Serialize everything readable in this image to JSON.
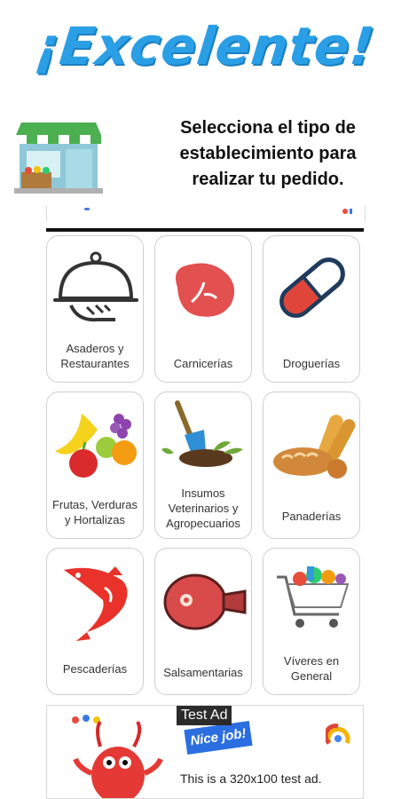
{
  "header": {
    "title": "¡Excelente!",
    "subtitle_lines": [
      "Selecciona el tipo de",
      "establecimiento para",
      "realizar tu pedido."
    ]
  },
  "categories": [
    {
      "label_lines": [
        "Asaderos y",
        "Restaurantes"
      ],
      "icon": "cloche-icon"
    },
    {
      "label_lines": [
        "Carnicerías"
      ],
      "icon": "steak-icon"
    },
    {
      "label_lines": [
        "Droguerías"
      ],
      "icon": "pill-icon"
    },
    {
      "label_lines": [
        "Frutas, Verduras",
        "y Hortalizas"
      ],
      "icon": "fruits-icon"
    },
    {
      "label_lines": [
        "Insumos",
        "Veterinarios y",
        "Agropecuarios"
      ],
      "icon": "shovel-plant-icon"
    },
    {
      "label_lines": [
        "Panaderías"
      ],
      "icon": "bread-icon"
    },
    {
      "label_lines": [
        "Pescaderías"
      ],
      "icon": "fish-icon"
    },
    {
      "label_lines": [
        "Salsamentarias"
      ],
      "icon": "ham-icon"
    },
    {
      "label_lines": [
        "Víveres en",
        "General"
      ],
      "icon": "shopping-cart-icon"
    }
  ],
  "ad": {
    "label": "Test Ad",
    "badge": "Nice job!",
    "text": "This is a 320x100 test ad."
  },
  "colors": {
    "title_blue": "#2a9fe6",
    "meat_red": "#e25050",
    "pill_red": "#e0453a",
    "pill_navy": "#1f3b5c",
    "fish_red": "#e8322a"
  }
}
